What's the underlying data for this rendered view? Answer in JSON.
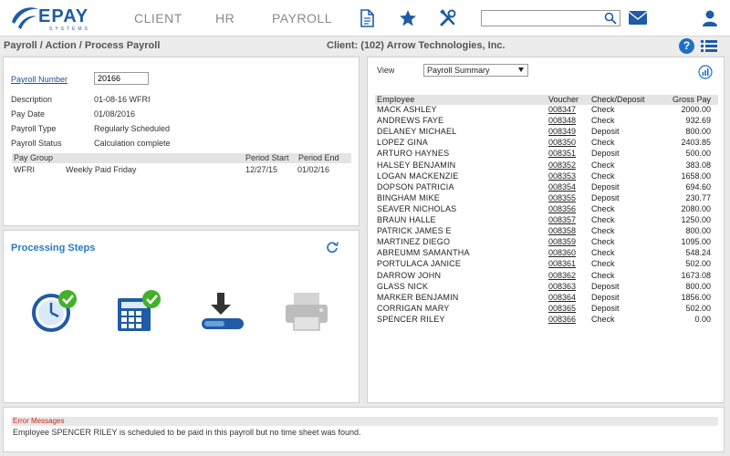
{
  "brand": {
    "name": "EPAY",
    "sub": "SYSTEMS"
  },
  "nav": {
    "client": "CLIENT",
    "hr": "HR",
    "payroll": "PAYROLL"
  },
  "search": {
    "placeholder": ""
  },
  "breadcrumb": "Payroll / Action / Process Payroll",
  "client_label": "Client: (102) Arrow Technologies, Inc.",
  "help_glyph": "?",
  "colors": {
    "accent": "#1f5ba6",
    "steps_title": "#2a7bbf",
    "check_green": "#43b02a",
    "error_red": "#d42020"
  },
  "payroll": {
    "number_label": "Payroll Number",
    "number_value": "20166",
    "description_label": "Description",
    "description_value": "01-08-16 WFRI",
    "pay_date_label": "Pay Date",
    "pay_date_value": "01/08/2016",
    "type_label": "Payroll Type",
    "type_value": "Regularly Scheduled",
    "status_label": "Payroll Status",
    "status_value": "Calculation complete",
    "group_headers": {
      "pay_group": "Pay Group",
      "period_start": "Period Start",
      "period_end": "Period End"
    },
    "group_row": {
      "code": "WFRI",
      "name": "Weekly Paid Friday",
      "start": "12/27/15",
      "end": "01/02/16"
    }
  },
  "steps": {
    "title": "Processing Steps",
    "icons": [
      "clock-check-icon",
      "calculator-check-icon",
      "download-icon",
      "printer-icon"
    ]
  },
  "employees": {
    "view_label": "View",
    "view_selected": "Payroll Summary",
    "headers": {
      "employee": "Employee",
      "voucher": "Voucher",
      "check_deposit": "Check/Deposit",
      "gross_pay": "Gross Pay"
    },
    "rows": [
      {
        "name": "MACK ASHLEY",
        "voucher": "008347",
        "type": "Check",
        "gross": "2000.00"
      },
      {
        "name": "ANDREWS FAYE",
        "voucher": "008348",
        "type": "Check",
        "gross": "932.69"
      },
      {
        "name": "DELANEY MICHAEL",
        "voucher": "008349",
        "type": "Deposit",
        "gross": "800.00"
      },
      {
        "name": "LOPEZ GINA",
        "voucher": "008350",
        "type": "Check",
        "gross": "2403.85"
      },
      {
        "name": "ARTURO HAYNES",
        "voucher": "008351",
        "type": "Deposit",
        "gross": "500.00"
      },
      {
        "name": "HALSEY BENJAMIN",
        "voucher": "008352",
        "type": "Check",
        "gross": "383.08"
      },
      {
        "name": "LOGAN MACKENZIE",
        "voucher": "008353",
        "type": "Check",
        "gross": "1658.00"
      },
      {
        "name": "DOPSON PATRICIA",
        "voucher": "008354",
        "type": "Deposit",
        "gross": "694.60"
      },
      {
        "name": "BINGHAM MIKE",
        "voucher": "008355",
        "type": "Deposit",
        "gross": "230.77"
      },
      {
        "name": "SEAVER NICHOLAS",
        "voucher": "008356",
        "type": "Check",
        "gross": "2080.00"
      },
      {
        "name": "BRAUN HALLE",
        "voucher": "008357",
        "type": "Check",
        "gross": "1250.00"
      },
      {
        "name": "PATRICK JAMES E",
        "voucher": "008358",
        "type": "Check",
        "gross": "800.00"
      },
      {
        "name": "MARTINEZ DIEGO",
        "voucher": "008359",
        "type": "Check",
        "gross": "1095.00"
      },
      {
        "name": "ABREUMM SAMANTHA",
        "voucher": "008360",
        "type": "Check",
        "gross": "548.24"
      },
      {
        "name": "PORTULACA JANICE",
        "voucher": "008361",
        "type": "Check",
        "gross": "502.00"
      },
      {
        "name": "DARROW JOHN",
        "voucher": "008362",
        "type": "Check",
        "gross": "1673.08"
      },
      {
        "name": "GLASS NICK",
        "voucher": "008363",
        "type": "Deposit",
        "gross": "800.00"
      },
      {
        "name": "MARKER BENJAMIN",
        "voucher": "008364",
        "type": "Deposit",
        "gross": "1856.00"
      },
      {
        "name": "CORRIGAN MARY",
        "voucher": "008365",
        "type": "Deposit",
        "gross": "502.00"
      },
      {
        "name": "SPENCER RILEY",
        "voucher": "008366",
        "type": "Check",
        "gross": "0.00"
      }
    ]
  },
  "errors": {
    "title": "Error Messages",
    "message": "Employee SPENCER RILEY is scheduled to be paid in this payroll but no time sheet was found."
  }
}
